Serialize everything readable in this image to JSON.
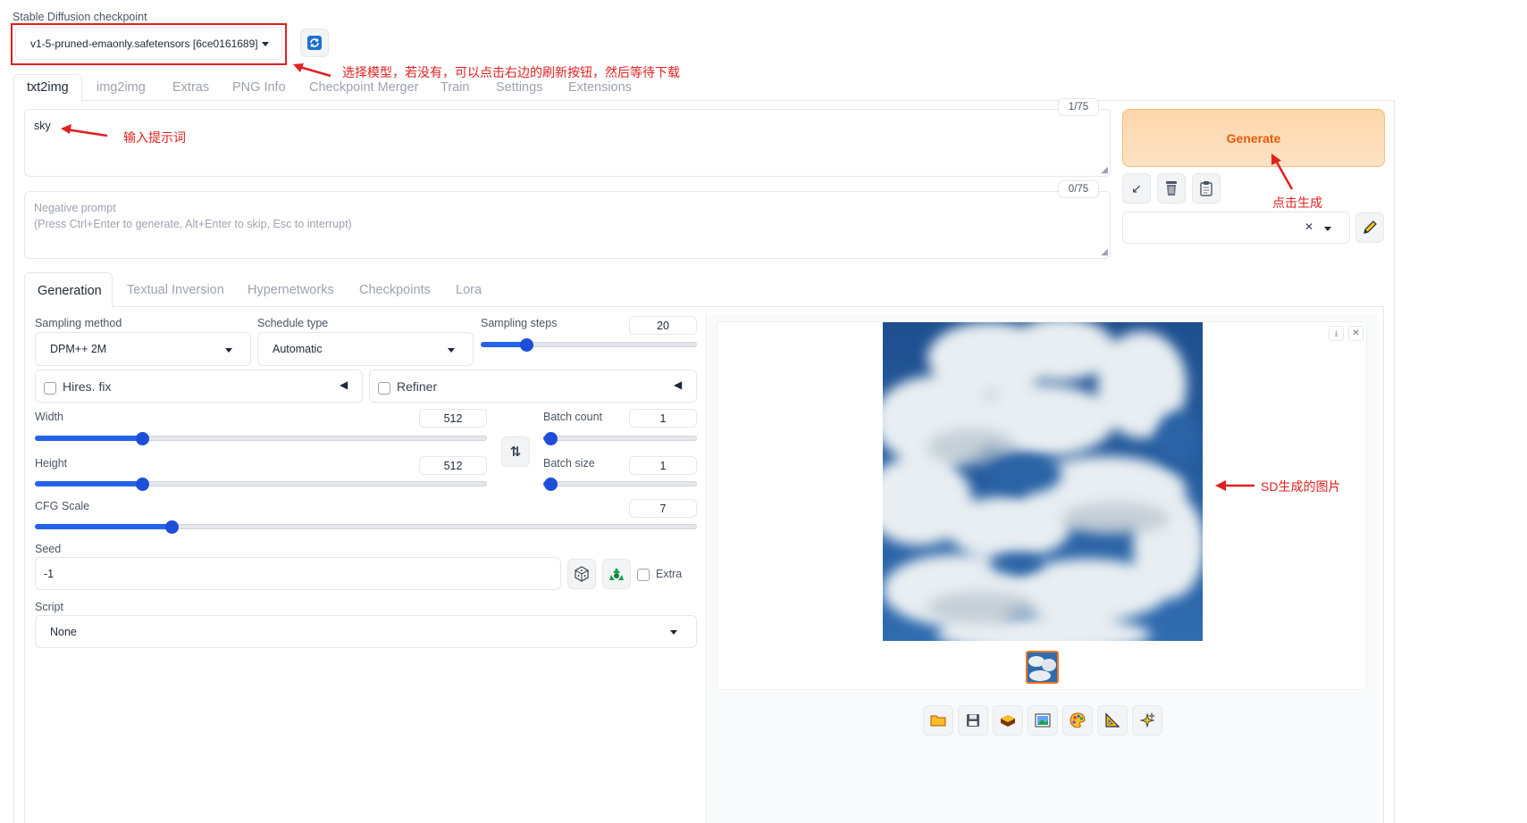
{
  "checkpoint": {
    "label": "Stable Diffusion checkpoint",
    "value": "v1-5-pruned-emaonly.safetensors [6ce0161689]"
  },
  "annotations": {
    "select_model": "选择模型，若没有，可以点击右边的刷新按钮，然后等待下载",
    "input_prompt": "输入提示词",
    "click_generate": "点击生成",
    "sd_image": "SD生成的图片"
  },
  "main_tabs": [
    "txt2img",
    "img2img",
    "Extras",
    "PNG Info",
    "Checkpoint Merger",
    "Train",
    "Settings",
    "Extensions"
  ],
  "prompt": {
    "value": "sky",
    "counter": "1/75"
  },
  "negative_prompt": {
    "placeholder_line1": "Negative prompt",
    "placeholder_line2": "(Press Ctrl+Enter to generate, Alt+Enter to skip, Esc to interrupt)",
    "counter": "0/75"
  },
  "generate_label": "Generate",
  "sub_tabs": [
    "Generation",
    "Textual Inversion",
    "Hypernetworks",
    "Checkpoints",
    "Lora"
  ],
  "sampling": {
    "method_label": "Sampling method",
    "method_value": "DPM++ 2M",
    "schedule_label": "Schedule type",
    "schedule_value": "Automatic",
    "steps_label": "Sampling steps",
    "steps_value": "20",
    "steps_fraction": 0.19
  },
  "hires_label": "Hires. fix",
  "refiner_label": "Refiner",
  "width": {
    "label": "Width",
    "value": "512",
    "fraction": 0.23
  },
  "height": {
    "label": "Height",
    "value": "512",
    "fraction": 0.23
  },
  "batch_count": {
    "label": "Batch count",
    "value": "1",
    "fraction": 0.0
  },
  "batch_size": {
    "label": "Batch size",
    "value": "1",
    "fraction": 0.0
  },
  "cfg": {
    "label": "CFG Scale",
    "value": "7",
    "fraction": 0.2
  },
  "seed": {
    "label": "Seed",
    "value": "-1",
    "extra_label": "Extra"
  },
  "script": {
    "label": "Script",
    "value": "None"
  },
  "colors": {
    "accent": "#2563eb",
    "generate_bg": "#fed7aa",
    "generate_text": "#ea580c",
    "annotation_red": "#e02020"
  }
}
